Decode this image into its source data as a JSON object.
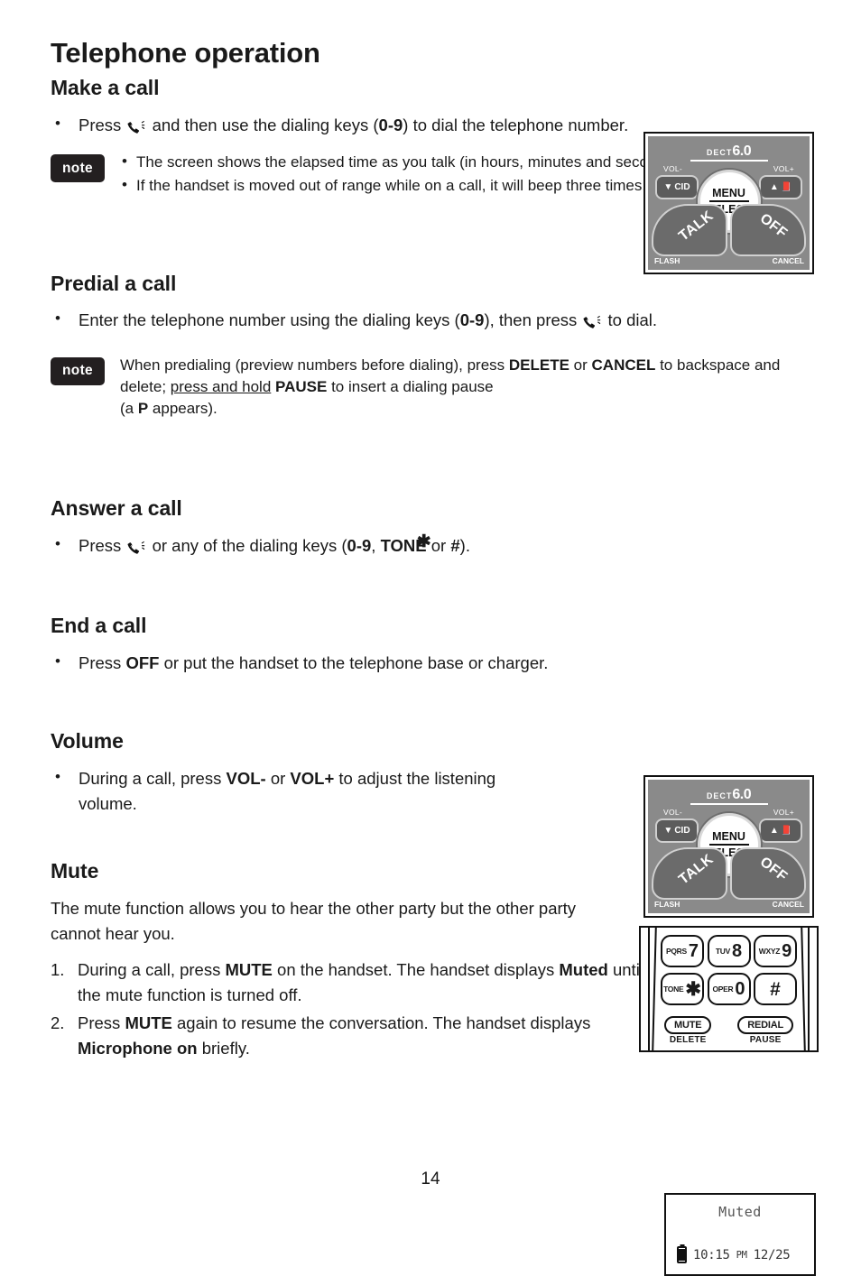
{
  "chapter_title": "Telephone operation",
  "page_number": "14",
  "sections": {
    "make_a_call": {
      "heading": "Make a call",
      "bullet_pre": "Press",
      "bullet_post_a": "and then use the dialing keys (",
      "keys_0_9": "0-9",
      "bullet_post_b": ") to dial the telephone number.",
      "note_label": "note",
      "note_items": [
        "The screen shows the elapsed time as you talk (in hours, minutes and seconds).",
        "If the handset is moved out of range while on a call, it will beep three times."
      ]
    },
    "predial_a_call": {
      "heading": "Predial a call",
      "bullet_pre": "Enter the telephone number using the dialing keys (",
      "keys_0_9": "0-9",
      "bullet_mid": "), then press",
      "bullet_post": "to dial.",
      "note_label": "note",
      "note_text_1": "When predialing (preview numbers before dialing), press ",
      "note_delete": "DELETE",
      "note_or": " or ",
      "note_cancel": "CANCEL",
      "note_text_2": " to backspace and delete; ",
      "note_press_hold": "press and hold",
      "note_pause": "PAUSE",
      "note_text_3": " to insert a dialing pause",
      "note_text_4": "(a ",
      "note_p": "P",
      "note_text_5": " appears)."
    },
    "answer_a_call": {
      "heading": "Answer a call",
      "bullet_pre": "Press",
      "bullet_mid": "or any of the dialing keys (",
      "keys_0_9": "0-9",
      "comma": ", ",
      "tone_label": "TONE",
      "tone_star": "✱",
      "or_label": " or ",
      "hash_label": "#",
      "bullet_post": ")."
    },
    "end_a_call": {
      "heading": "End a call",
      "bullet_pre": "Press ",
      "off_label": "OFF",
      "bullet_post": " or put the handset to the telephone base or charger."
    },
    "volume": {
      "heading": "Volume",
      "bullet_pre": "During a call, press ",
      "vol_minus": "VOL-",
      "or_label": " or ",
      "vol_plus": "VOL+",
      "bullet_post": " to adjust the listening volume."
    },
    "mute": {
      "heading": "Mute",
      "intro": "The mute function allows you to hear the other party but the other party cannot hear you.",
      "step1_pre": "During a call, press ",
      "step1_mute": "MUTE",
      "step1_mid": " on the handset. The handset displays ",
      "step1_muted": "Muted",
      "step1_post": " until the mute function is turned off.",
      "step2_pre": "Press ",
      "step2_mute": "MUTE",
      "step2_mid": " again to resume the conversation. The handset displays ",
      "step2_mic": "Microphone on",
      "step2_post": " briefly."
    }
  },
  "figures": {
    "handset_keys": {
      "brand_small": "DECT",
      "brand_big": "6.0",
      "vol_minus_label": "VOL-",
      "vol_plus_label": "VOL+",
      "cid_button": "CID",
      "dir_button": "☰",
      "menu_line1": "MENU",
      "menu_line2": "SELECT",
      "talk_button": "TALK",
      "off_button": "OFF",
      "flash_label": "FLASH",
      "cancel_label": "CANCEL"
    },
    "keypad": {
      "keys": [
        {
          "letters": "PQRS",
          "digit": "7"
        },
        {
          "letters": "TUV",
          "digit": "8"
        },
        {
          "letters": "WXYZ",
          "digit": "9"
        },
        {
          "letters": "TONE",
          "digit": "✱"
        },
        {
          "letters": "OPER",
          "digit": "0"
        },
        {
          "letters": "",
          "digit": "#"
        }
      ],
      "mute_button": "MUTE",
      "mute_sub": "DELETE",
      "redial_button": "REDIAL",
      "redial_sub": "PAUSE"
    },
    "lcd": {
      "title": "Muted",
      "time": "10:15",
      "ampm": "PM",
      "date": "12/25"
    }
  },
  "colors": {
    "note_badge_bg": "#231f20",
    "phone_body": "#8a8a8a",
    "text": "#1a1a1a"
  }
}
